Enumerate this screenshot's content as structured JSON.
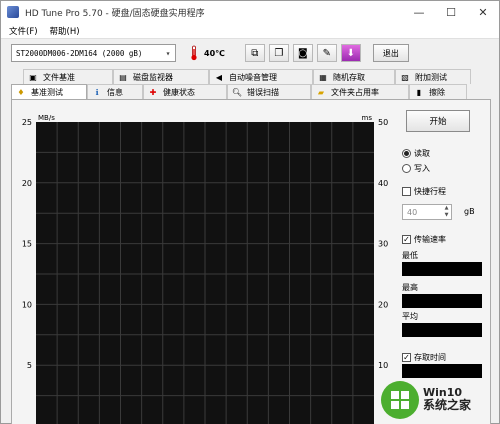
{
  "window": {
    "title": "HD Tune Pro 5.70 - 硬盘/固态硬盘实用程序",
    "controls": [
      "—",
      "☐",
      "✕"
    ]
  },
  "menu": [
    "文件(F)",
    "帮助(H)"
  ],
  "toolbar": {
    "drive": "ST2000DM006-2DM164 (2000 gB)",
    "temperature": "40℃",
    "exit_label": "退出"
  },
  "tabs": {
    "row1": [
      {
        "label": "文件基准",
        "icon": "folder-benchmark-icon"
      },
      {
        "label": "磁盘监视器",
        "icon": "monitor-icon"
      },
      {
        "label": "自动噪音管理",
        "icon": "speaker-icon"
      },
      {
        "label": "随机存取",
        "icon": "random-access-icon"
      },
      {
        "label": "附加测试",
        "icon": "extra-tests-icon"
      }
    ],
    "row2": [
      {
        "label": "基准测试",
        "icon": "benchmark-icon"
      },
      {
        "label": "信息",
        "icon": "info-icon"
      },
      {
        "label": "健康状态",
        "icon": "health-icon"
      },
      {
        "label": "错误扫描",
        "icon": "error-scan-icon"
      },
      {
        "label": "文件夹占用率",
        "icon": "folder-usage-icon"
      },
      {
        "label": "擦除",
        "icon": "erase-icon"
      }
    ],
    "active": "基准测试"
  },
  "side": {
    "start_label": "开始",
    "read_label": "读取",
    "write_label": "写入",
    "mode_selected": "读取",
    "short_stroke_label": "快捷行程",
    "short_stroke_checked": false,
    "short_stroke_value": "40",
    "short_stroke_unit": "gB",
    "transfer_rate_label": "传输速率",
    "transfer_rate_checked": true,
    "min_label": "最低",
    "max_label": "最高",
    "avg_label": "平均",
    "access_time_label": "存取时间",
    "access_time_checked": true
  },
  "chart_data": {
    "type": "line",
    "left_axis_unit": "MB/s",
    "right_axis_unit": "ms",
    "left_ticks": [
      25,
      20,
      15,
      10,
      5
    ],
    "right_ticks": [
      50,
      40,
      30,
      20,
      10
    ],
    "ylim_left": [
      0,
      25
    ],
    "ylim_right": [
      0,
      50
    ],
    "grid": true,
    "series": []
  },
  "watermark": {
    "line1": "Win10",
    "line2": "系统之家",
    "color": "#4cae2f"
  }
}
